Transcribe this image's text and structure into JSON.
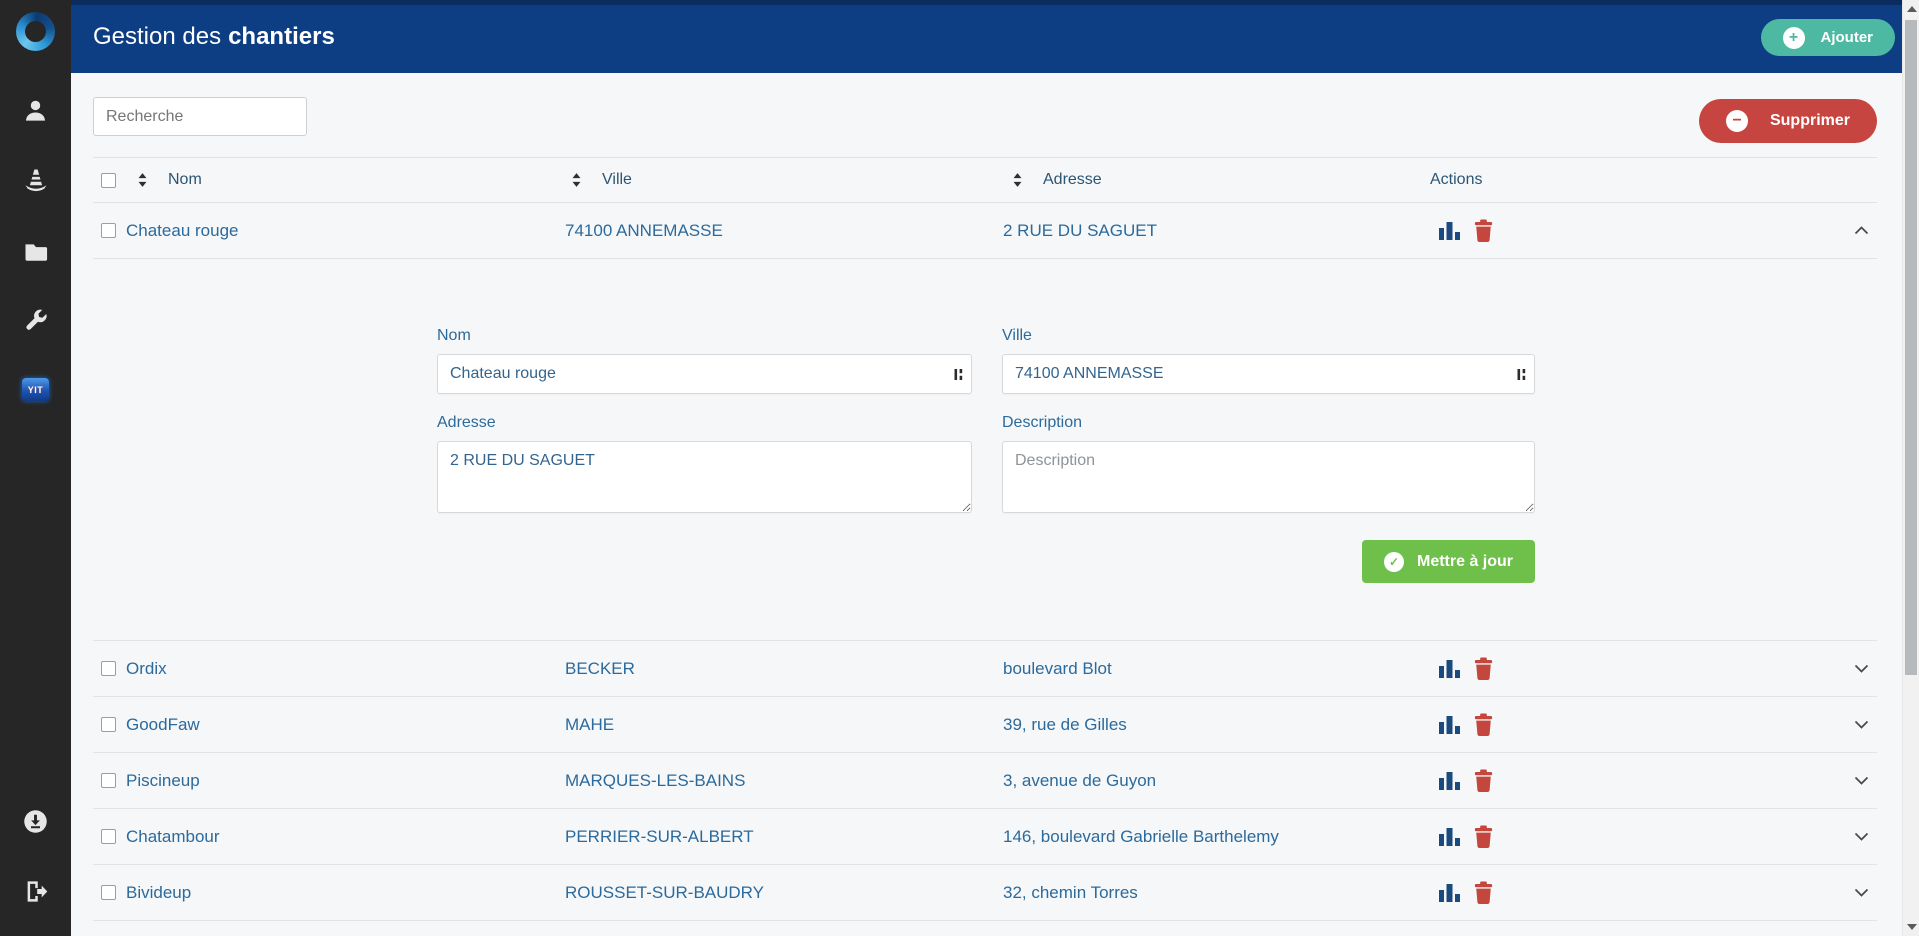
{
  "header": {
    "title_prefix": "Gestion des",
    "title_bold": "chantiers",
    "add_label": "Ajouter",
    "add_icon": "+"
  },
  "toolbar": {
    "search_placeholder": "Recherche",
    "delete_label": "Supprimer",
    "delete_icon": "−"
  },
  "sidebar": {
    "yit_label": "YIT",
    "icons": [
      "user",
      "traffic-cone",
      "folder",
      "wrench",
      "yit-app",
      "download",
      "sign-out"
    ]
  },
  "table": {
    "columns": {
      "nom": "Nom",
      "ville": "Ville",
      "adresse": "Adresse",
      "actions": "Actions"
    },
    "rows": [
      {
        "nom": "Chateau rouge",
        "ville": "74100 ANNEMASSE",
        "adresse": "2 RUE DU SAGUET",
        "expanded": true
      },
      {
        "nom": "Ordix",
        "ville": "BECKER",
        "adresse": "boulevard Blot",
        "expanded": false
      },
      {
        "nom": "GoodFaw",
        "ville": "MAHE",
        "adresse": "39, rue de Gilles",
        "expanded": false
      },
      {
        "nom": "Piscineup",
        "ville": "MARQUES-LES-BAINS",
        "adresse": "3, avenue de Guyon",
        "expanded": false
      },
      {
        "nom": "Chatambour",
        "ville": "PERRIER-SUR-ALBERT",
        "adresse": "146, boulevard Gabrielle Barthelemy",
        "expanded": false
      },
      {
        "nom": "Bivideup",
        "ville": "ROUSSET-SUR-BAUDRY",
        "adresse": "32, chemin Torres",
        "expanded": false
      }
    ]
  },
  "edit_form": {
    "nom_label": "Nom",
    "nom_value": "Chateau rouge",
    "ville_label": "Ville",
    "ville_value": "74100 ANNEMASSE",
    "adresse_label": "Adresse",
    "adresse_value": "2 RUE DU SAGUET",
    "description_label": "Description",
    "description_placeholder": "Description",
    "submit_label": "Mettre à jour"
  },
  "colors": {
    "header_bg": "#0d3e84",
    "sidebar_bg": "#262626",
    "add_button": "#4db9a2",
    "delete_button": "#c64540",
    "update_button": "#6fbf4b",
    "link_text": "#2b6a9d",
    "trash_red": "#c5463d",
    "chart_navy": "#1b4a7e"
  }
}
